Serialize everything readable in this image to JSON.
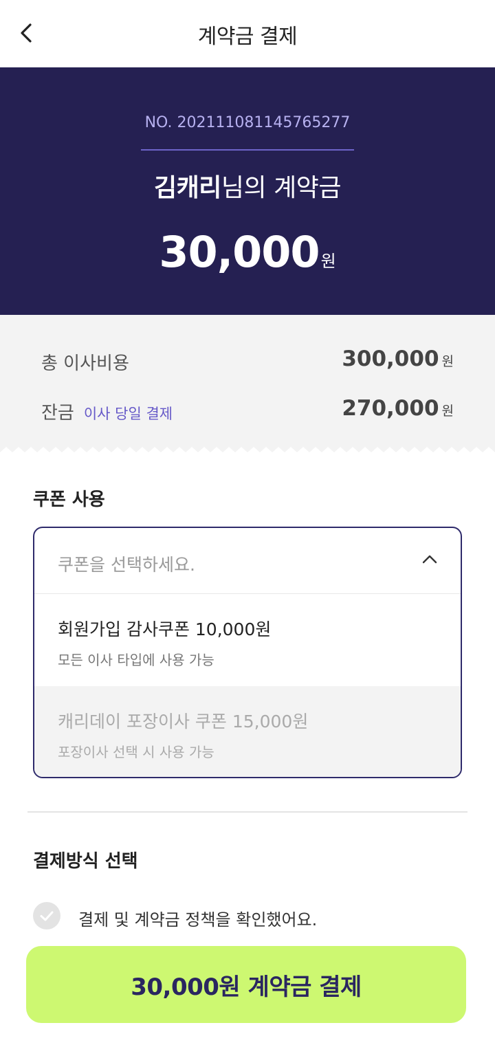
{
  "header": {
    "title": "계약금 결제"
  },
  "contract": {
    "order_no": "NO. 202111081145765277",
    "customer_name": "김캐리",
    "title_suffix": "님의 계약금",
    "amount": "30,000",
    "amount_unit": "원"
  },
  "summary": {
    "total": {
      "label": "총 이사비용",
      "value": "300,000",
      "unit": "원"
    },
    "balance": {
      "label": "잔금",
      "sub": "이사 당일 결제",
      "value": "270,000",
      "unit": "원"
    }
  },
  "coupon": {
    "section_title": "쿠폰 사용",
    "placeholder": "쿠폰을 선택하세요.",
    "options": [
      {
        "name": "회원가입 감사쿠폰 10,000원",
        "desc": "모든 이사 타입에 사용 가능",
        "disabled": false
      },
      {
        "name": "캐리데이 포장이사 쿠폰 15,000원",
        "desc": "포장이사 선택 시 사용 가능",
        "disabled": true
      }
    ]
  },
  "payment_method": {
    "section_title": "결제방식 선택"
  },
  "agreement": {
    "label": "결제 및 계약금 정책을 확인했어요.",
    "checked": false
  },
  "cta": {
    "label": "30,000원 계약금 결제"
  },
  "colors": {
    "hero_bg": "#252052",
    "accent_purple": "#6558c8",
    "cta_bg": "#cdf871",
    "cta_text": "#2a2660"
  }
}
